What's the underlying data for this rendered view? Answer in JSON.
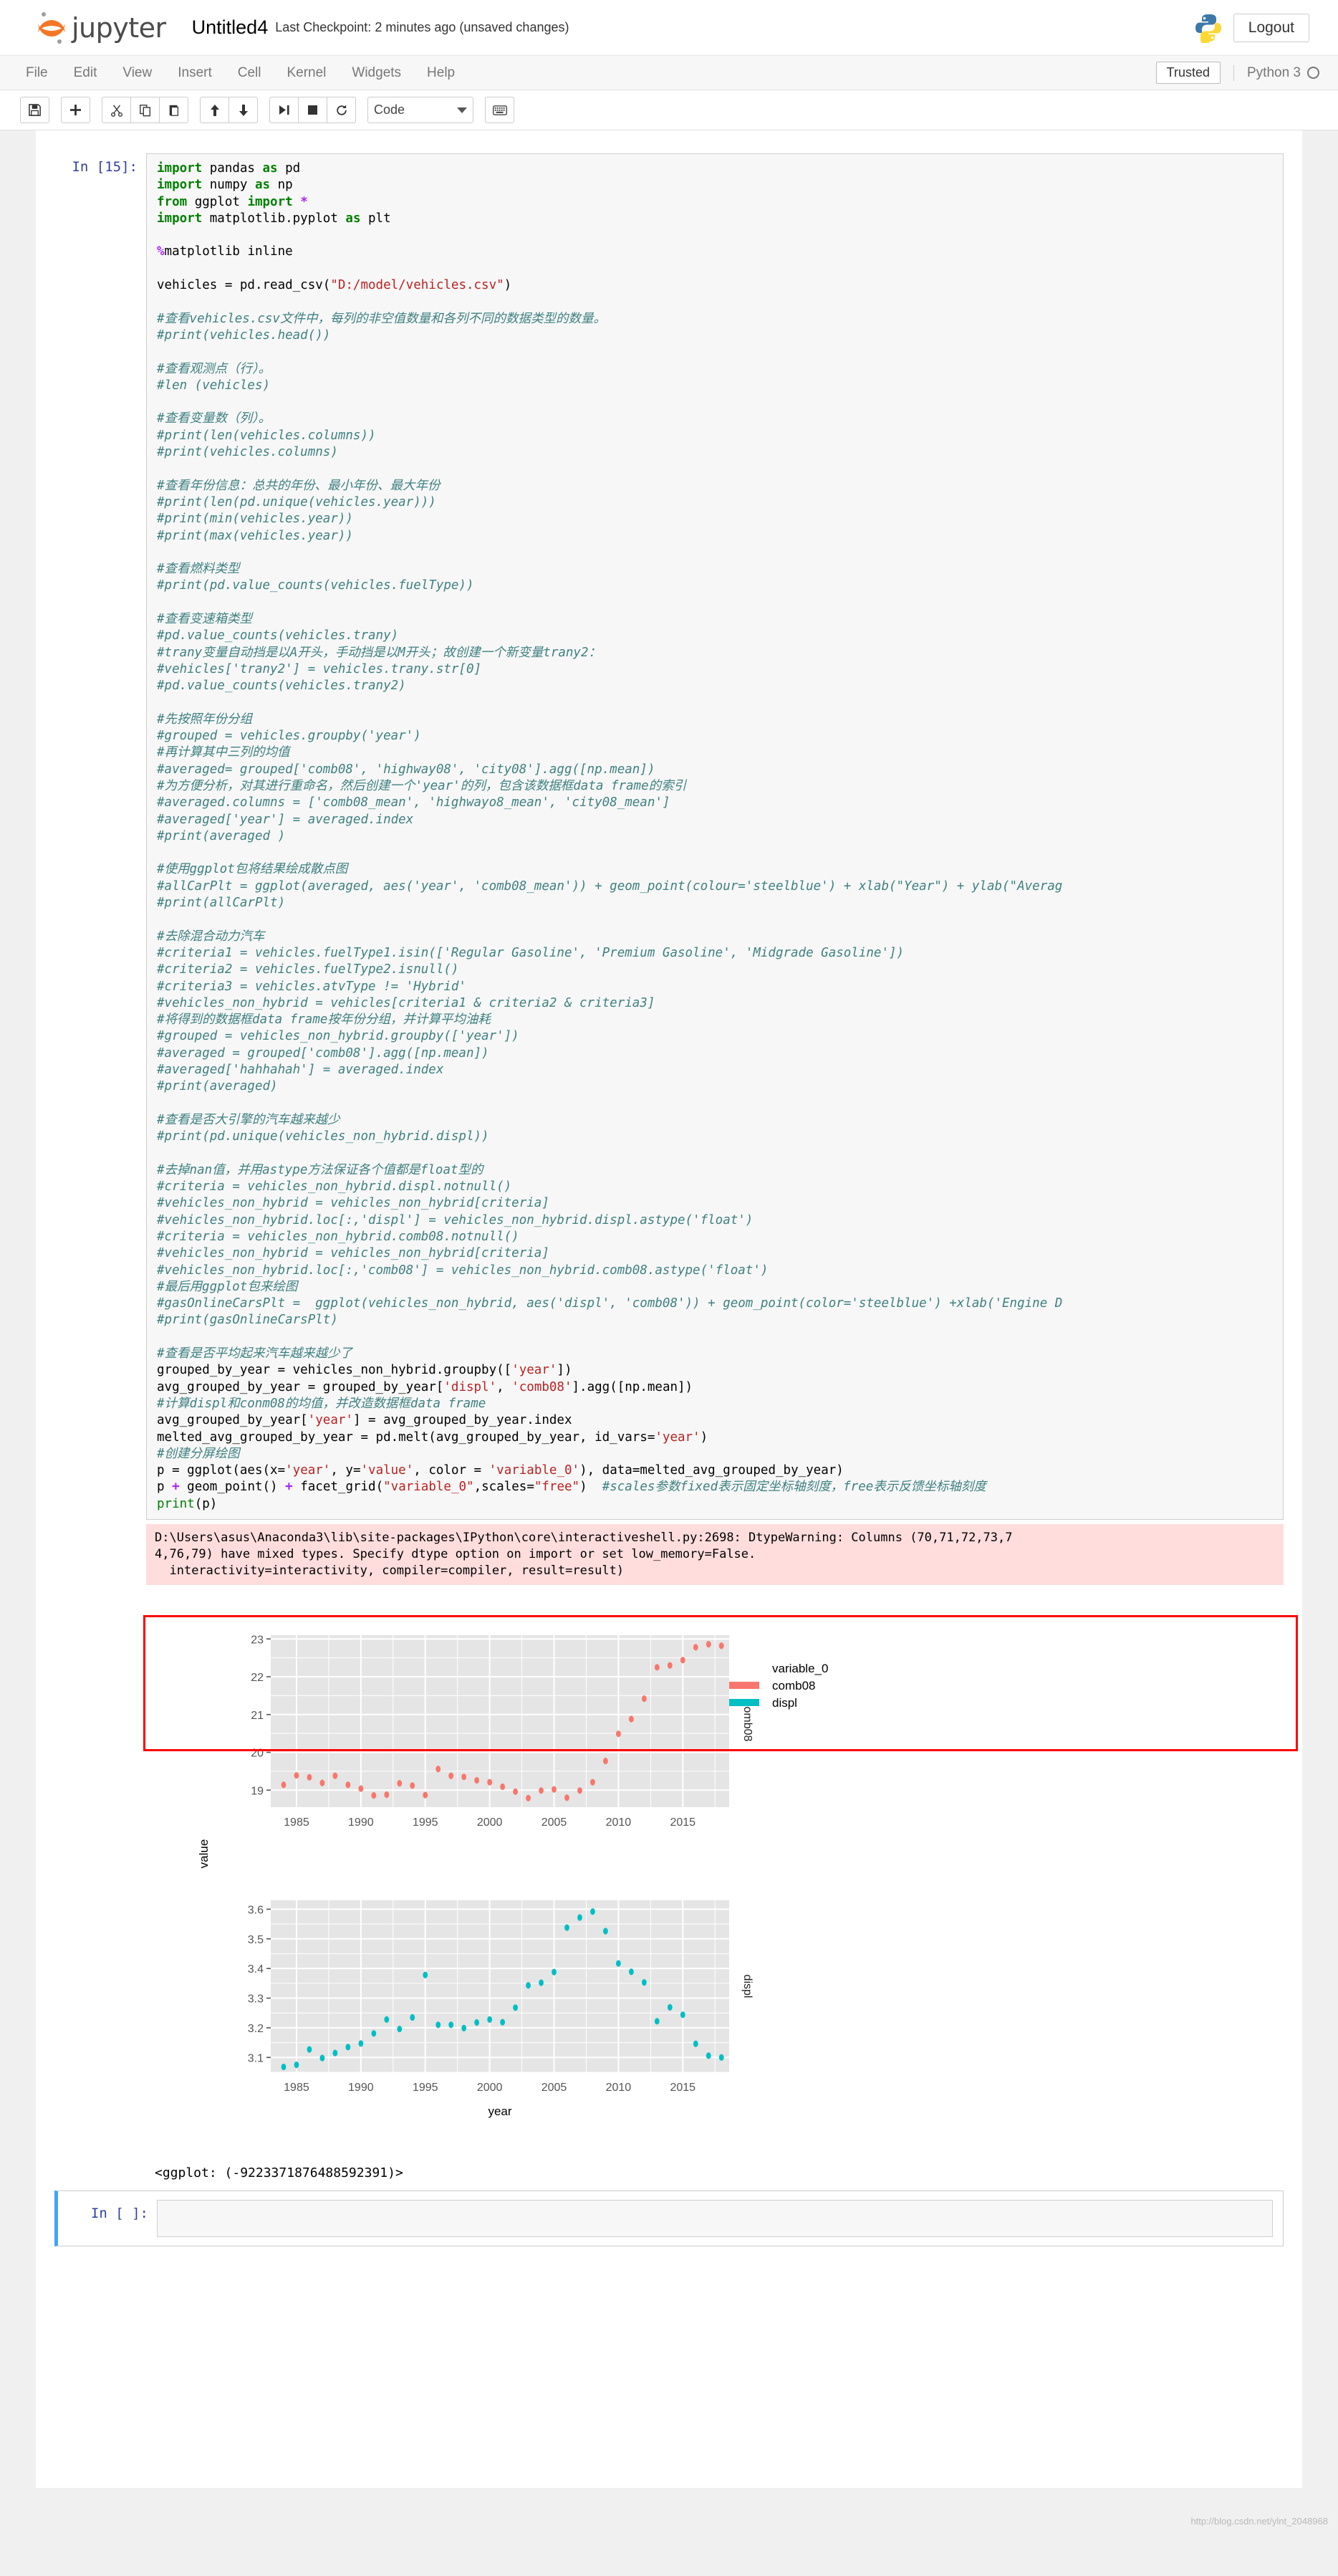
{
  "header": {
    "brand": "jupyter",
    "notebook_title": "Untitled4",
    "checkpoint": "Last Checkpoint: 2 minutes ago (unsaved changes)",
    "logout_label": "Logout"
  },
  "menubar": {
    "items": [
      "File",
      "Edit",
      "View",
      "Insert",
      "Cell",
      "Kernel",
      "Widgets",
      "Help"
    ],
    "trusted_label": "Trusted",
    "kernel_name": "Python 3"
  },
  "toolbar": {
    "save_title": "save-icon",
    "insert_title": "plus-icon",
    "cut_title": "scissors-icon",
    "copy_title": "copy-icon",
    "paste_title": "paste-icon",
    "up_title": "arrow-up-icon",
    "down_title": "arrow-down-icon",
    "run_title": "run-icon",
    "stop_title": "stop-icon",
    "restart_title": "restart-icon",
    "cell_type": "Code",
    "keyboard_title": "keyboard-icon"
  },
  "cells": [
    {
      "prompt": "In [15]:",
      "code_lines": [
        {
          "t": "kw",
          "s": "import",
          "r": " pandas ",
          "k2": "as",
          "r2": " pd"
        },
        {
          "t": "kw",
          "s": "import",
          "r": " numpy ",
          "k2": "as",
          "r2": " np"
        },
        {
          "t": "kw",
          "s": "from",
          "r": " ggplot ",
          "k2": "import",
          "r2": " *"
        },
        {
          "t": "kw",
          "s": "import",
          "r": " matplotlib.pyplot ",
          "k2": "as",
          "r2": " plt"
        }
      ]
    }
  ],
  "code": {
    "line_01": "import pandas as pd",
    "line_02": "import numpy as np",
    "line_03": "from ggplot import *",
    "line_04": "import matplotlib.pyplot as plt",
    "line_05": "",
    "line_06": "%matplotlib inline",
    "line_07": "",
    "line_08": "vehicles = pd.read_csv(\"D:/model/vehicles.csv\")",
    "line_09": "",
    "line_10": "#查看vehicles.csv文件中，每列的非空值数量和各列不同的数据类型的数量。",
    "line_11": "#print(vehicles.head())",
    "line_12": "",
    "line_13": "#查看观测点（行）。",
    "line_14": "#len (vehicles)",
    "line_15": "",
    "line_16": "#查看变量数（列）。",
    "line_17": "#print(len(vehicles.columns))",
    "line_18": "#print(vehicles.columns)",
    "line_19": "",
    "line_20": "#查看年份信息：总共的年份、最小年份、最大年份",
    "line_21": "#print(len(pd.unique(vehicles.year)))",
    "line_22": "#print(min(vehicles.year))",
    "line_23": "#print(max(vehicles.year))",
    "line_24": "",
    "line_25": "#查看燃料类型",
    "line_26": "#print(pd.value_counts(vehicles.fuelType))",
    "line_27": "",
    "line_28": "#查看变速箱类型",
    "line_29": "#pd.value_counts(vehicles.trany)",
    "line_30": "#trany变量自动挡是以A开头，手动挡是以M开头；故创建一个新变量trany2：",
    "line_31": "#vehicles['trany2'] = vehicles.trany.str[0]",
    "line_32": "#pd.value_counts(vehicles.trany2)",
    "line_33": "",
    "line_34": "#先按照年份分组",
    "line_35": "#grouped = vehicles.groupby('year')",
    "line_36": "#再计算其中三列的均值",
    "line_37": "#averaged= grouped['comb08', 'highway08', 'city08'].agg([np.mean])",
    "line_38": "#为方便分析，对其进行重命名，然后创建一个'year'的列，包含该数据框data frame的索引",
    "line_39": "#averaged.columns = ['comb08_mean', 'highwayo8_mean', 'city08_mean']",
    "line_40": "#averaged['year'] = averaged.index",
    "line_41": "#print(averaged )",
    "line_42": "",
    "line_43": "#使用ggplot包将结果绘成散点图",
    "line_44": "#allCarPlt = ggplot(averaged, aes('year', 'comb08_mean')) + geom_point(colour='steelblue') + xlab(\"Year\") + ylab(\"Averag",
    "line_45": "#print(allCarPlt)",
    "line_46": "",
    "line_47": "#去除混合动力汽车",
    "line_48": "#criteria1 = vehicles.fuelType1.isin(['Regular Gasoline', 'Premium Gasoline', 'Midgrade Gasoline'])",
    "line_49": "#criteria2 = vehicles.fuelType2.isnull()",
    "line_50": "#criteria3 = vehicles.atvType != 'Hybrid'",
    "line_51": "#vehicles_non_hybrid = vehicles[criteria1 & criteria2 & criteria3]",
    "line_52": "#将得到的数据框data frame按年份分组，并计算平均油耗",
    "line_53": "#grouped = vehicles_non_hybrid.groupby(['year'])",
    "line_54": "#averaged = grouped['comb08'].agg([np.mean])",
    "line_55": "#averaged['hahhahah'] = averaged.index",
    "line_56": "#print(averaged)",
    "line_57": "",
    "line_58": "#查看是否大引擎的汽车越来越少",
    "line_59": "#print(pd.unique(vehicles_non_hybrid.displ))",
    "line_60": "",
    "line_61": "#去掉nan值，并用astype方法保证各个值都是float型的",
    "line_62": "#criteria = vehicles_non_hybrid.displ.notnull()",
    "line_63": "#vehicles_non_hybrid = vehicles_non_hybrid[criteria]",
    "line_64": "#vehicles_non_hybrid.loc[:,'displ'] = vehicles_non_hybrid.displ.astype('float')",
    "line_65": "#criteria = vehicles_non_hybrid.comb08.notnull()",
    "line_66": "#vehicles_non_hybrid = vehicles_non_hybrid[criteria]",
    "line_67": "#vehicles_non_hybrid.loc[:,'comb08'] = vehicles_non_hybrid.comb08.astype('float')",
    "line_68": "#最后用ggplot包来绘图",
    "line_69": "#gasOnlineCarsPlt =  ggplot(vehicles_non_hybrid, aes('displ', 'comb08')) + geom_point(color='steelblue') +xlab('Engine D",
    "line_70": "#print(gasOnlineCarsPlt)",
    "line_71": "",
    "line_72": "#查看是否平均起来汽车越来越少了",
    "line_73": "grouped_by_year = vehicles_non_hybrid.groupby(['year'])",
    "line_74": "avg_grouped_by_year = grouped_by_year['displ', 'comb08'].agg([np.mean])",
    "line_75": "#计算displ和conm08的均值，并改造数据框data frame",
    "line_76": "avg_grouped_by_year['year'] = avg_grouped_by_year.index",
    "line_77": "melted_avg_grouped_by_year = pd.melt(avg_grouped_by_year, id_vars='year')",
    "line_78": "#创建分屏绘图",
    "line_79": "p = ggplot(aes(x='year', y='value', color = 'variable_0'), data=melted_avg_grouped_by_year)",
    "line_80": "p + geom_point() + facet_grid(\"variable_0\",scales=\"free\")  #scales参数fixed表示固定坐标轴刻度，free表示反馈坐标轴刻度",
    "line_81": "print(p)"
  },
  "output": {
    "warning_line1": "D:\\Users\\asus\\Anaconda3\\lib\\site-packages\\IPython\\core\\interactiveshell.py:2698: DtypeWarning: Columns (70,71,72,73,7",
    "warning_line2": "4,76,79) have mixed types. Specify dtype option on import or set low_memory=False.",
    "warning_line3": "  interactivity=interactivity, compiler=compiler, result=result)",
    "repr_text": "<ggplot: (-9223371876488592391)>"
  },
  "empty_cell": {
    "prompt": "In [ ]:",
    "placeholder": ""
  },
  "watermark": "http://blog.csdn.net/ylnt_2048968",
  "colors": {
    "comb08": "#f8766d",
    "displ": "#00bfc4",
    "panel_bg": "#e5e5e5",
    "grid": "#ffffff",
    "warn_bg": "#ffdddd",
    "annotation_red": "#ff0000"
  },
  "chart_data": {
    "type": "scatter",
    "title": "",
    "xlabel": "year",
    "ylabel": "value",
    "legend_title": "variable_0",
    "legend_entries": [
      "comb08",
      "displ"
    ],
    "legend_position": "right",
    "grid": true,
    "facet_var": "variable_0",
    "scales": "free",
    "panels": [
      {
        "facet_label": "comb08",
        "color": "#f8766d",
        "ylim": [
          18.55,
          23.1
        ],
        "yticks": [
          19,
          20,
          21,
          22,
          23
        ],
        "xlim": [
          1983,
          2018.6
        ],
        "xticks": [
          1985,
          1990,
          1995,
          2000,
          2005,
          2010,
          2015
        ],
        "x": [
          1984,
          1985,
          1986,
          1987,
          1988,
          1989,
          1990,
          1991,
          1992,
          1993,
          1994,
          1995,
          1996,
          1997,
          1998,
          1999,
          2000,
          2001,
          2002,
          2003,
          2004,
          2005,
          2006,
          2007,
          2008,
          2009,
          2010,
          2011,
          2012,
          2013,
          2014,
          2015,
          2016,
          2017,
          2018
        ],
        "y": [
          19.14,
          19.39,
          19.34,
          19.19,
          19.38,
          19.14,
          19.04,
          18.86,
          18.88,
          19.18,
          19.12,
          18.87,
          19.56,
          19.38,
          19.35,
          19.26,
          19.21,
          19.09,
          18.96,
          18.79,
          18.99,
          19.02,
          18.8,
          18.99,
          19.21,
          19.77,
          20.49,
          20.88,
          21.42,
          22.25,
          22.3,
          22.44,
          22.78,
          22.86,
          22.82
        ]
      },
      {
        "facet_label": "displ",
        "color": "#00bfc4",
        "ylim": [
          3.05,
          3.63
        ],
        "yticks": [
          3.1,
          3.2,
          3.3,
          3.4,
          3.5,
          3.6
        ],
        "xlim": [
          1983,
          2018.6
        ],
        "xticks": [
          1985,
          1990,
          1995,
          2000,
          2005,
          2010,
          2015
        ],
        "x": [
          1984,
          1985,
          1986,
          1987,
          1988,
          1989,
          1990,
          1991,
          1992,
          1993,
          1994,
          1995,
          1996,
          1997,
          1998,
          1999,
          2000,
          2001,
          2002,
          2003,
          2004,
          2005,
          2006,
          2007,
          2008,
          2009,
          2010,
          2011,
          2012,
          2013,
          2014,
          2015,
          2016,
          2017,
          2018
        ],
        "y": [
          3.068,
          3.075,
          3.127,
          3.098,
          3.115,
          3.135,
          3.147,
          3.181,
          3.228,
          3.196,
          3.235,
          3.378,
          3.21,
          3.21,
          3.199,
          3.218,
          3.228,
          3.219,
          3.268,
          3.343,
          3.352,
          3.388,
          3.538,
          3.572,
          3.592,
          3.526,
          3.417,
          3.389,
          3.353,
          3.222,
          3.269,
          3.244,
          3.146,
          3.106,
          3.1
        ]
      }
    ]
  }
}
